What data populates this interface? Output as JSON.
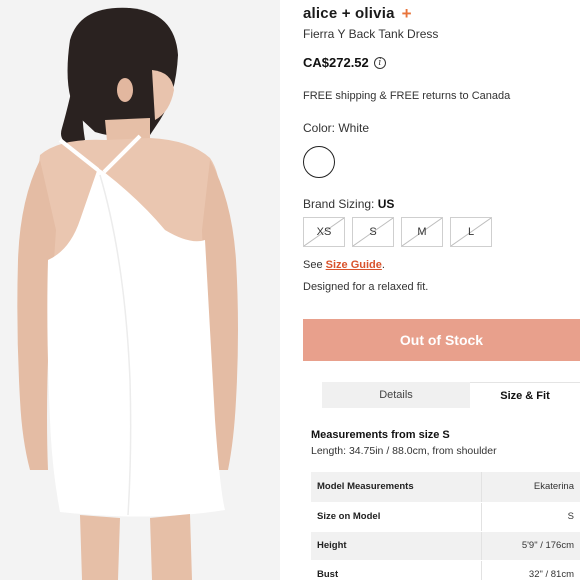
{
  "product": {
    "brand": "alice + olivia",
    "plus_icon": "plus",
    "name": "Fierra Y Back Tank Dress",
    "price": "CA$272.52",
    "price_info_icon": "info-circle",
    "info_glyph": "i",
    "shipping": "FREE shipping & FREE returns to Canada"
  },
  "color": {
    "label": "Color: White",
    "swatch_color": "#ffffff"
  },
  "sizing": {
    "label": "Brand Sizing:",
    "system": "US",
    "sizes": [
      {
        "label": "XS",
        "available": false
      },
      {
        "label": "S",
        "available": false
      },
      {
        "label": "M",
        "available": false
      },
      {
        "label": "L",
        "available": false
      }
    ],
    "guide_prefix": "See",
    "guide_link": "Size Guide",
    "guide_suffix": ".",
    "fit_note": "Designed for a relaxed fit."
  },
  "cta": {
    "label": "Out of Stock",
    "color": "#e8a08c"
  },
  "tabs": {
    "details": "Details",
    "size_fit": "Size & Fit",
    "active": "Size & Fit"
  },
  "measurements": {
    "title": "Measurements from size S",
    "length": "Length: 34.75in / 88.0cm, from shoulder",
    "table": {
      "header_label": "Model Measurements",
      "header_value": "Ekaterina",
      "rows": [
        {
          "label": "Size on Model",
          "value": "S"
        },
        {
          "label": "Height",
          "value": "5'9\" / 176cm"
        },
        {
          "label": "Bust",
          "value": "32\" / 81cm"
        }
      ]
    }
  },
  "accent_colors": {
    "brand_plus": "#e8743b",
    "link": "#d9532c"
  }
}
